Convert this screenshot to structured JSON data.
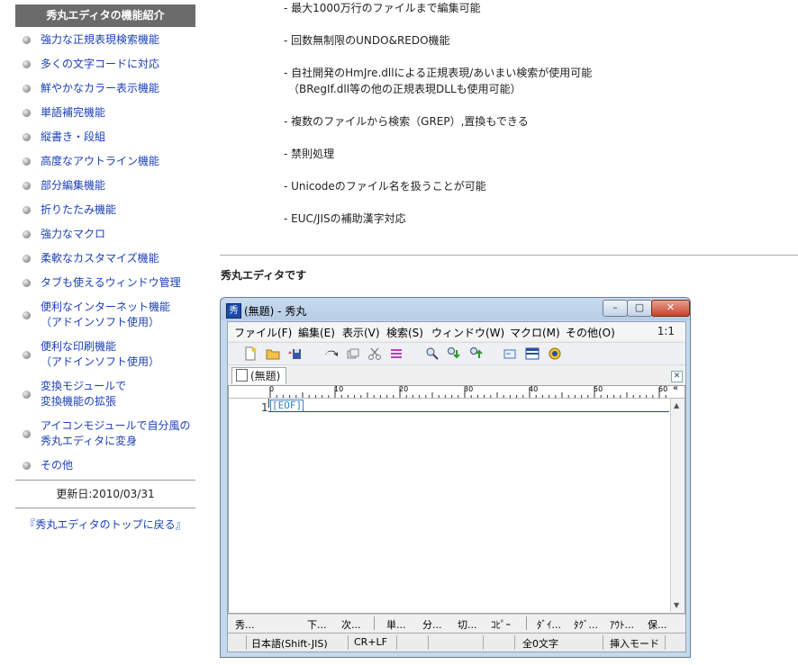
{
  "sidebar": {
    "heading": "秀丸エディタの機能紹介",
    "items": [
      {
        "lines": [
          "強力な正規表現検索機能"
        ]
      },
      {
        "lines": [
          "多くの文字コードに対応"
        ]
      },
      {
        "lines": [
          "鮮やかなカラー表示機能"
        ]
      },
      {
        "lines": [
          "単語補完機能"
        ]
      },
      {
        "lines": [
          "縦書き・段組"
        ]
      },
      {
        "lines": [
          "高度なアウトライン機能"
        ]
      },
      {
        "lines": [
          "部分編集機能"
        ]
      },
      {
        "lines": [
          "折りたたみ機能"
        ]
      },
      {
        "lines": [
          "強力なマクロ"
        ]
      },
      {
        "lines": [
          "柔軟なカスタマイズ機能"
        ]
      },
      {
        "lines": [
          "タブも使えるウィンドウ管理"
        ]
      },
      {
        "lines": [
          "便利なインターネット機能",
          "（アドインソフト使用）"
        ]
      },
      {
        "lines": [
          "便利な印刷機能",
          "（アドインソフト使用）"
        ]
      },
      {
        "lines": [
          "変換モジュールで",
          "変換機能の拡張"
        ]
      },
      {
        "lines": [
          "アイコンモジュールで自分風の",
          "秀丸エディタに変身"
        ]
      },
      {
        "lines": [
          "その他"
        ]
      }
    ],
    "updated": "更新日:2010/03/31",
    "back_link": "『秀丸エディタのトップに戻る』"
  },
  "features": [
    "- 最大1000万行のファイルまで編集可能",
    "- 回数無制限のUNDO&REDO機能",
    "- 自社開発のHmJre.dllによる正規表現/あいまい検索が使用可能",
    "（BRegIf.dll等の他の正規表現DLLも使用可能）",
    "- 複数のファイルから検索（GREP）,置換もできる",
    "- 禁則処理",
    "- Unicodeのファイル名を扱うことが可能",
    "- EUC/JISの補助漢字対応"
  ],
  "caption": "秀丸エディタです",
  "window": {
    "title": "(無題) - 秀丸",
    "app_icon_glyph": "秀",
    "menus": [
      "ファイル(F)",
      "編集(E)",
      "表示(V)",
      "検索(S)",
      "ウィンドウ(W)",
      "マクロ(M)",
      "その他(O)"
    ],
    "ratio": "1:1",
    "tab_label": "(無題)",
    "ruler_marks": [
      "0",
      "10",
      "20",
      "30",
      "40",
      "50",
      "60"
    ],
    "ruler_arrows": "«",
    "line_number": "1",
    "eof_marker": "[EOF]",
    "function_keys": [
      "秀...",
      "下...",
      "次...",
      "単...",
      "分...",
      "切...",
      "ｺﾋﾟｰ",
      "ﾀﾞｲ...",
      "ﾀｸﾞ...",
      "ｱｳﾄ...",
      "保..."
    ],
    "status": {
      "encoding": "日本語(Shift-JIS)",
      "newline": "CR+LF",
      "char_count": "全0文字",
      "mode": "挿入モード"
    }
  }
}
